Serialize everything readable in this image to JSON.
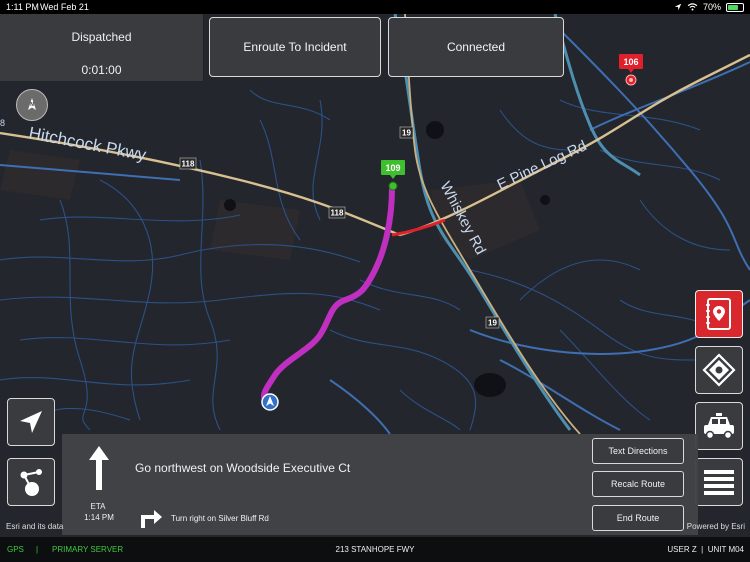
{
  "status_bar": {
    "time": "1:11 PM",
    "date": "Wed Feb 21",
    "battery": "70%",
    "battery_level": 0.7
  },
  "incident": {
    "status": "Dispatched",
    "timer": "0:01:00"
  },
  "status_buttons": {
    "enroute": "Enroute To Incident",
    "connected": "Connected"
  },
  "map": {
    "streets": {
      "hitchcock": "Hitchcock Pkwy",
      "pine_log": "E Pine Log Rd",
      "whiskey": "Whiskey Rd"
    },
    "shields": {
      "r118_a": "118",
      "r118_b": "118",
      "r19_a": "19",
      "r19_b": "19"
    },
    "markers": {
      "unit_109": "109",
      "unit_106": "106"
    },
    "edge_label": "8",
    "colors": {
      "route": "#c030c0",
      "roads": "#3f6fb3",
      "highway": "#d8c090",
      "incident": "#e0202a",
      "unit": "#3fbf2f"
    }
  },
  "directions": {
    "instruction": "Go northwest on Woodside Executive Ct",
    "eta_label": "ETA",
    "eta_time": "1:14 PM",
    "next_instruction": "Turn right on Silver Bluff Rd",
    "buttons": {
      "text_directions": "Text Directions",
      "recalc_route": "Recalc Route",
      "end_route": "End Route"
    }
  },
  "attribution": "Esri and its data",
  "powered_by": "Powered by Esri",
  "bottom_bar": {
    "gps": "GPS",
    "separator": "|",
    "server": "PRIMARY SERVER",
    "address": "213 STANHOPE FWY",
    "user": "USER Z  |  UNIT M04"
  }
}
